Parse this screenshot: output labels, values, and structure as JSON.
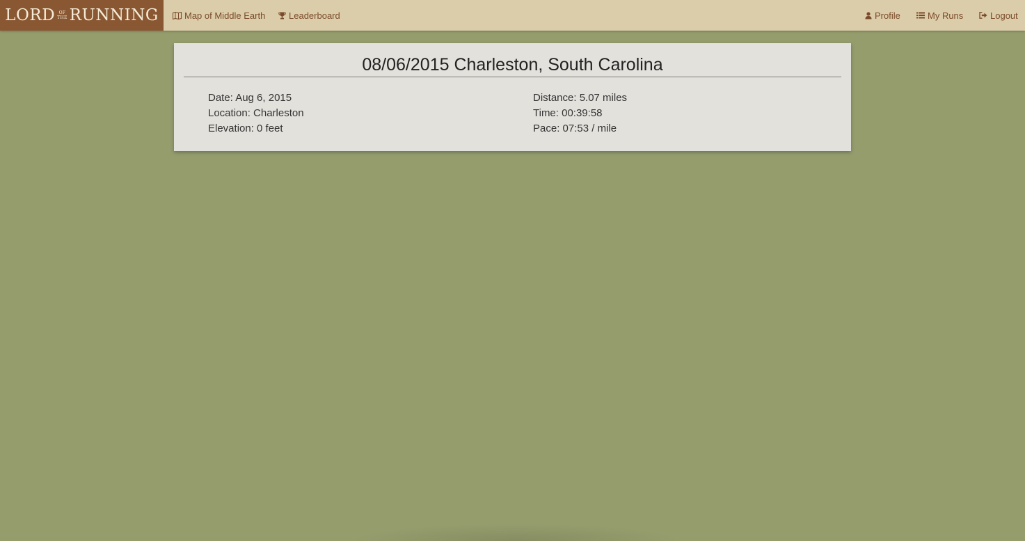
{
  "brand": {
    "word1": "LORD",
    "small_top": "OF",
    "small_bottom": "THE",
    "word2": "RUNNING"
  },
  "nav": {
    "left": [
      {
        "label": "Map of Middle Earth",
        "icon": "map-icon"
      },
      {
        "label": "Leaderboard",
        "icon": "trophy-icon"
      }
    ],
    "right": [
      {
        "label": "Profile",
        "icon": "user-icon"
      },
      {
        "label": "My Runs",
        "icon": "list-icon"
      },
      {
        "label": "Logout",
        "icon": "logout-icon"
      }
    ]
  },
  "run": {
    "title": "08/06/2015 Charleston, South Carolina",
    "date": "Date: Aug 6, 2015",
    "location": "Location: Charleston",
    "elevation": "Elevation: 0 feet",
    "distance": "Distance: 5.07 miles",
    "time": "Time: 00:39:58",
    "pace": "Pace: 07:53 / mile"
  },
  "colors": {
    "background": "#959d6d",
    "navbar": "#dccdaa",
    "brand": "#8a5733",
    "nav_text": "#7a4a2a",
    "card": "#e3e1dc"
  }
}
